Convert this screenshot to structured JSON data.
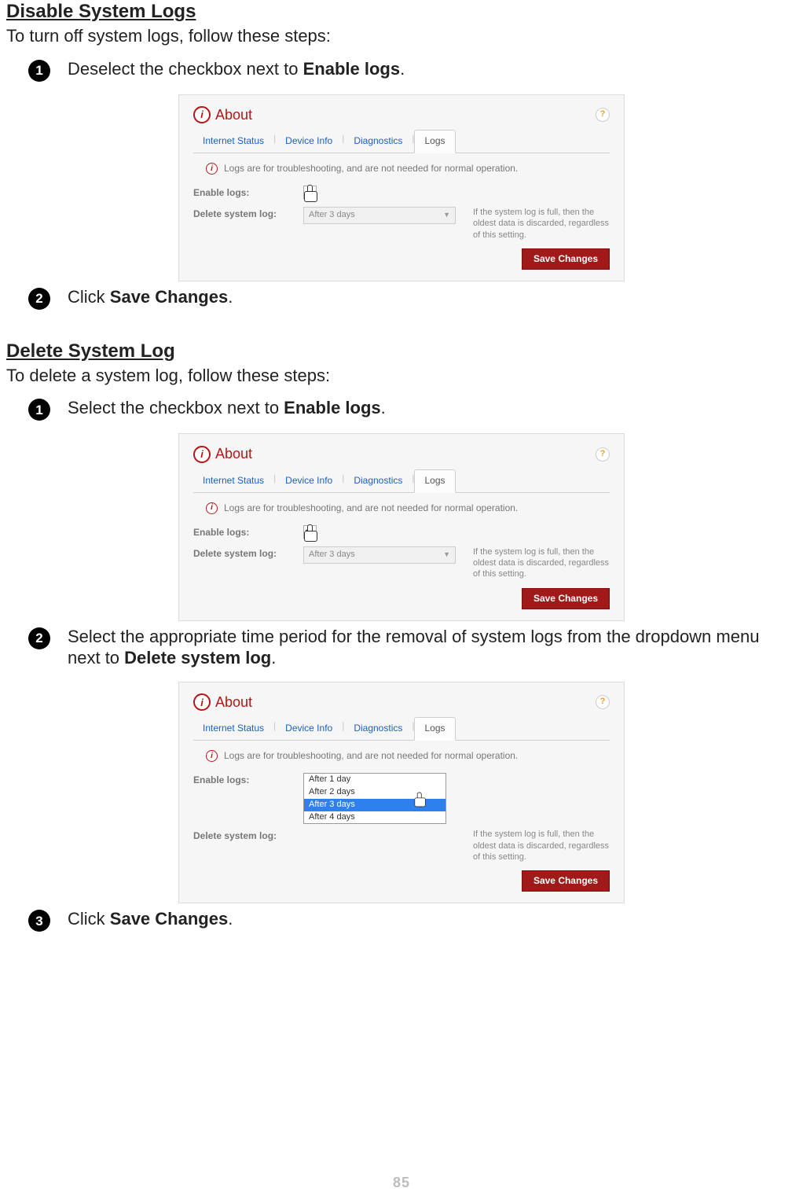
{
  "sections": {
    "disable": {
      "title": "Disable System Logs",
      "intro": "To turn off system logs, follow these steps:",
      "steps": {
        "s1_a": "Deselect the checkbox next to ",
        "s1_b": "Enable logs",
        "s1_c": ".",
        "s2_a": "Click ",
        "s2_b": "Save Changes",
        "s2_c": "."
      }
    },
    "delete": {
      "title": "Delete System Log",
      "intro": "To delete a system log, follow these steps:",
      "steps": {
        "s1_a": "Select the checkbox next to ",
        "s1_b": "Enable logs",
        "s1_c": ".",
        "s2_a": "Select the appropriate time period for the removal of system logs from the dropdown menu next to ",
        "s2_b": "Delete system log",
        "s2_c": ".",
        "s3_a": "Click ",
        "s3_b": "Save Changes",
        "s3_c": "."
      }
    }
  },
  "panel": {
    "title": "About",
    "help": "?",
    "tabs": {
      "internet": "Internet Status",
      "device": "Device Info",
      "diag": "Diagnostics",
      "logs": "Logs"
    },
    "info_line": "Logs are for troubleshooting, and are not needed for normal operation.",
    "labels": {
      "enable": "Enable logs:",
      "delete": "Delete system log:"
    },
    "dropdown_value": "After 3 days",
    "dropdown_options": [
      "After 1 day",
      "After 2 days",
      "After 3 days",
      "After 4 days"
    ],
    "hint": "If the system log is full, then the oldest data is discarded, regardless of this setting.",
    "save_btn": "Save Changes"
  },
  "page_number": "85",
  "nums": {
    "n1": "1",
    "n2": "2",
    "n3": "3"
  }
}
